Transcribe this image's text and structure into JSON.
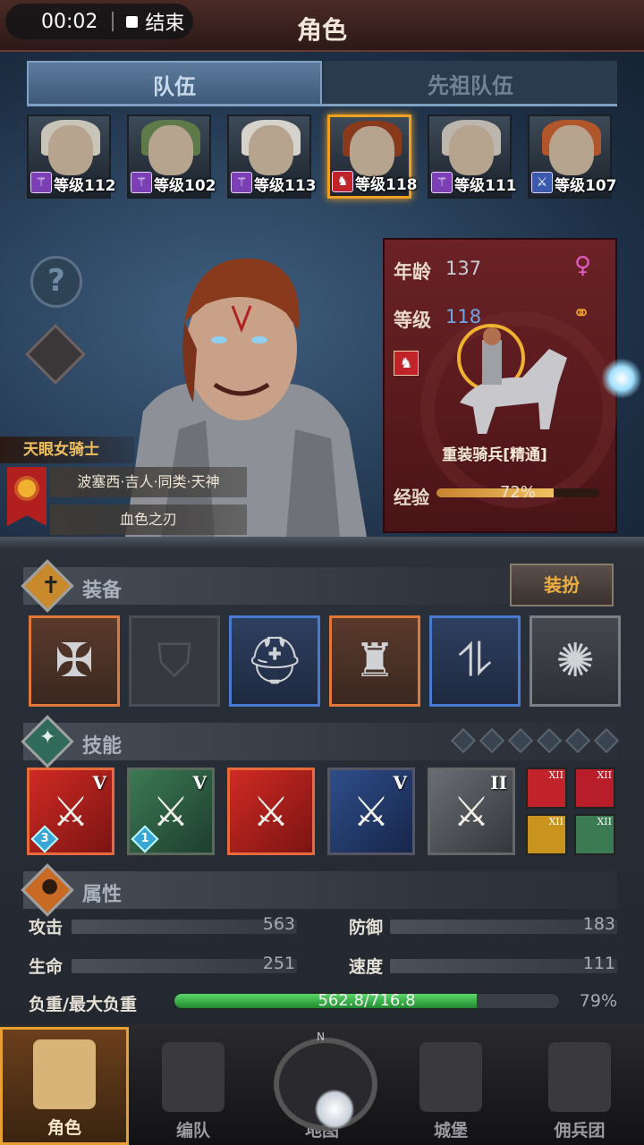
{
  "header": {
    "timer": "00:02",
    "end_label": "结束",
    "title": "角色"
  },
  "tabs": [
    {
      "label": "队伍",
      "active": true
    },
    {
      "label": "先祖队伍",
      "active": false
    }
  ],
  "team": [
    {
      "level": "等级112",
      "class_icon": "staff-icon",
      "hair": "#c9c4b8",
      "selected": false
    },
    {
      "level": "等级102",
      "class_icon": "staff-icon",
      "hair": "#5e7a48",
      "selected": false
    },
    {
      "level": "等级113",
      "class_icon": "staff-icon",
      "hair": "#d6d3cc",
      "selected": false
    },
    {
      "level": "等级118",
      "class_icon": "horse-icon",
      "hair": "#8a3a1c",
      "selected": true
    },
    {
      "level": "等级111",
      "class_icon": "staff-icon",
      "hair": "#bdb6ae",
      "selected": false
    },
    {
      "level": "等级107",
      "class_icon": "sword-icon",
      "hair": "#b0562a",
      "selected": false
    }
  ],
  "character": {
    "title": "天眼女骑士",
    "origin": "波塞西·吉人·同类·天神",
    "trait": "血色之刃",
    "age_label": "年龄",
    "age": "137",
    "level_label": "等级",
    "level": "118",
    "gender_icon": "female-icon",
    "relation_icon": "rings-icon",
    "class_name": "重装骑兵[精通]",
    "exp_label": "经验",
    "exp_text": "72%",
    "exp_fraction": 0.72
  },
  "equipment": {
    "title": "装备",
    "dress_button": "装扮",
    "slots": [
      {
        "name": "weapon",
        "style": "orange"
      },
      {
        "name": "shield",
        "style": "empty"
      },
      {
        "name": "helmet",
        "style": "blue"
      },
      {
        "name": "armor",
        "style": "orange"
      },
      {
        "name": "boots",
        "style": "blue"
      },
      {
        "name": "amulet",
        "style": "gray"
      }
    ]
  },
  "skills": {
    "title": "技能",
    "list": [
      {
        "style": "red",
        "rank": "V",
        "stack": "3"
      },
      {
        "style": "green",
        "rank": "V",
        "stack": "1"
      },
      {
        "style": "red",
        "rank": "",
        "stack": ""
      },
      {
        "style": "blue",
        "rank": "V",
        "stack": ""
      },
      {
        "style": "gray",
        "rank": "II",
        "stack": ""
      }
    ],
    "minis": [
      {
        "rank": "XII",
        "color": "#c0242a"
      },
      {
        "rank": "XII",
        "color": "#b81e2a"
      },
      {
        "rank": "XII",
        "color": "#c8941e"
      },
      {
        "rank": "XII",
        "color": "#3c7a54"
      }
    ]
  },
  "attributes": {
    "title": "属性",
    "attack_label": "攻击",
    "attack": "563",
    "defense_label": "防御",
    "defense": "183",
    "hp_label": "生命",
    "hp": "251",
    "speed_label": "速度",
    "speed": "111",
    "load_label": "负重/最大负重",
    "load_text": "562.8/716.8",
    "load_percent": "79%",
    "load_fraction": 0.785
  },
  "nav": [
    {
      "label": "角色",
      "active": true
    },
    {
      "label": "编队",
      "active": false
    },
    {
      "label": "地图",
      "active": false
    },
    {
      "label": "城堡",
      "active": false
    },
    {
      "label": "佣兵团",
      "active": false
    }
  ]
}
